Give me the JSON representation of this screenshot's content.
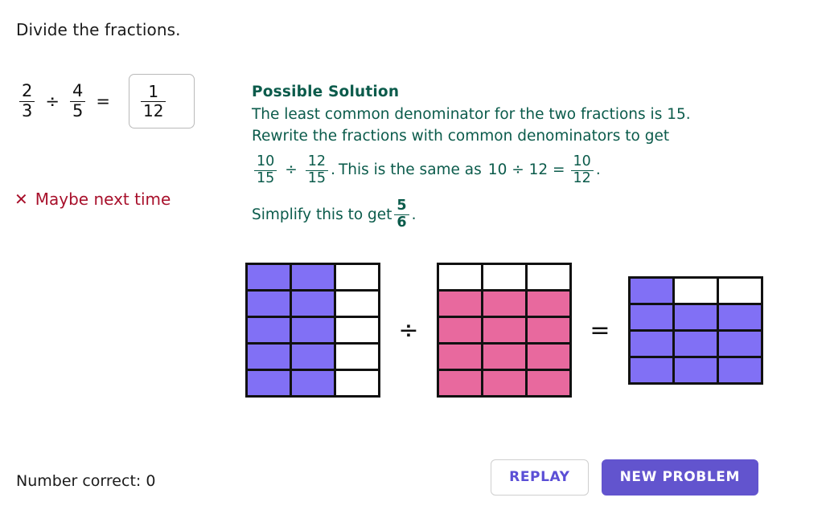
{
  "prompt": "Divide the fractions.",
  "problem": {
    "left": {
      "num": "2",
      "den": "3"
    },
    "divide_symbol": "÷",
    "right": {
      "num": "4",
      "den": "5"
    },
    "equals_symbol": "=",
    "answer": {
      "num": "1",
      "den": "12"
    }
  },
  "feedback": {
    "icon": "cross-icon",
    "icon_glyph": "✕",
    "text": "Maybe next time",
    "color": "#A8102B"
  },
  "solution": {
    "title": "Possible Solution",
    "line1": "The least common denominator for the two fractions is 15.",
    "line2": "Rewrite the fractions with common denominators to get",
    "equation": {
      "frac1": {
        "num": "10",
        "den": "15"
      },
      "divide_symbol": "÷",
      "frac2": {
        "num": "12",
        "den": "15"
      },
      "period": ".",
      "text": "This is the same as",
      "plain_expr": "10 ÷ 12 =",
      "result": {
        "num": "10",
        "den": "12"
      },
      "end_period": "."
    },
    "simplify": {
      "text": "Simplify this to get",
      "frac": {
        "num": "5",
        "den": "6"
      },
      "end_period": "."
    },
    "color": "#0B5B4B"
  },
  "diagrams": {
    "operator_divide": "÷",
    "operator_equals": "=",
    "grids": [
      {
        "name": "grid-dividend",
        "columns": 3,
        "rows": 5,
        "total_cells": 15,
        "filled_cells": 10,
        "fill_color": "#8170F5",
        "fill_class": "purple",
        "fill_pattern": "columns-1-2",
        "represents": "10/15"
      },
      {
        "name": "grid-divisor",
        "columns": 3,
        "rows": 5,
        "total_cells": 15,
        "filled_cells": 12,
        "fill_color": "#E8699E",
        "fill_class": "pink",
        "fill_pattern": "rows-2-5",
        "represents": "12/15"
      },
      {
        "name": "grid-quotient",
        "columns": 3,
        "rows": 4,
        "total_cells": 12,
        "filled_cells": 10,
        "fill_color": "#8170F5",
        "fill_class": "purple",
        "fill_pattern": "all-except-top-right-two",
        "represents": "10/12"
      }
    ]
  },
  "footer": {
    "counter_label": "Number correct: 0",
    "replay_label": "REPLAY",
    "new_problem_label": "NEW PROBLEM"
  }
}
